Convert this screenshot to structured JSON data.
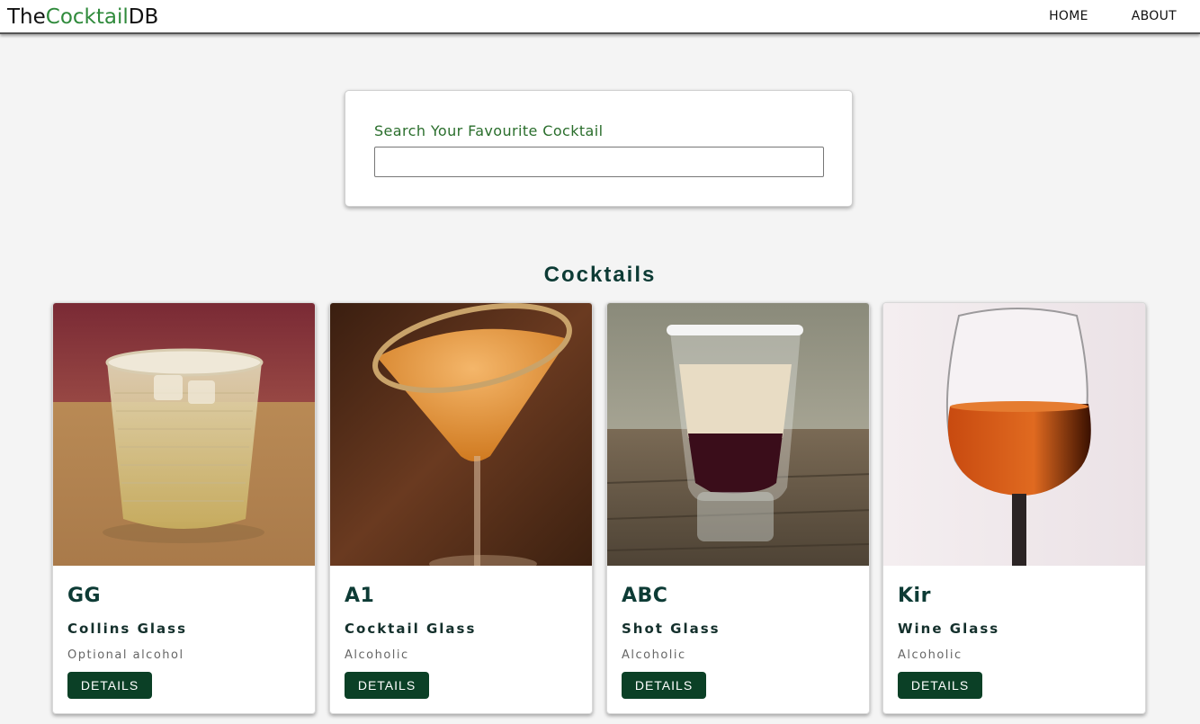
{
  "navbar": {
    "logo_prefix": "The",
    "logo_highlight": "Cocktail",
    "logo_suffix": "DB",
    "links": [
      "HOME",
      "ABOUT"
    ]
  },
  "search": {
    "label": "Search Your Favourite Cocktail",
    "value": ""
  },
  "section_title": "Cocktails",
  "cards": [
    {
      "name": "GG",
      "glass": "Collins Glass",
      "alcoholic": "Optional alcohol",
      "button": "DETAILS"
    },
    {
      "name": "A1",
      "glass": "Cocktail Glass",
      "alcoholic": "Alcoholic",
      "button": "DETAILS"
    },
    {
      "name": "ABC",
      "glass": "Shot Glass",
      "alcoholic": "Alcoholic",
      "button": "DETAILS"
    },
    {
      "name": "Kir",
      "glass": "Wine Glass",
      "alcoholic": "Alcoholic",
      "button": "DETAILS"
    }
  ],
  "colors": {
    "brand_green": "#2f8a3b",
    "button_green": "#0b4026",
    "title_teal": "#0d3b35"
  }
}
